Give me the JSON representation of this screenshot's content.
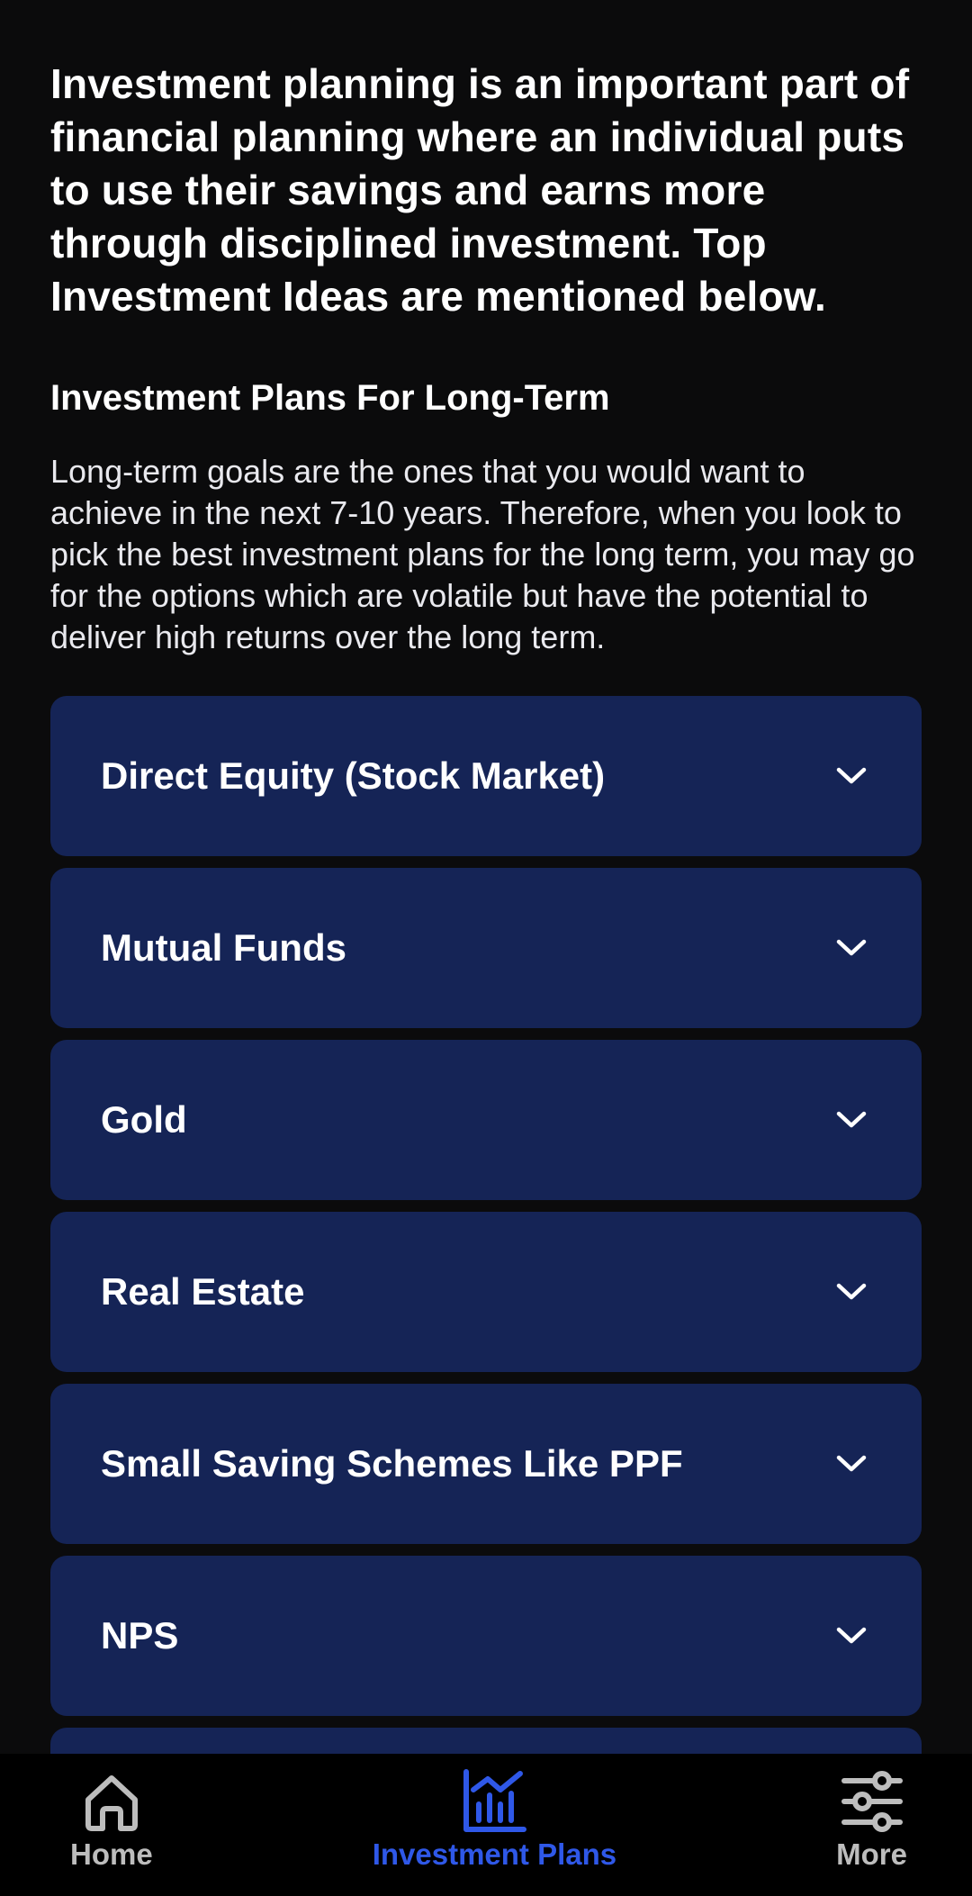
{
  "intro_text": "Investment planning is an important part of financial planning where an individual puts to use their savings and earns more through disciplined investment. Top Investment Ideas are mentioned below.",
  "section": {
    "title": "Investment Plans For Long-Term",
    "description": "Long-term goals are the ones that you would want to achieve in the next 7-10 years. Therefore, when you look to pick the best investment plans for the long term, you may go for the options which are volatile but have the potential to deliver high returns over the long term."
  },
  "accordion": {
    "items": [
      {
        "label": "Direct Equity (Stock Market)",
        "icon": "chevron-down-icon"
      },
      {
        "label": "Mutual Funds",
        "icon": "chevron-down-icon"
      },
      {
        "label": "Gold",
        "icon": "chevron-down-icon"
      },
      {
        "label": "Real Estate",
        "icon": "chevron-down-icon"
      },
      {
        "label": "Small Saving Schemes Like PPF",
        "icon": "chevron-down-icon"
      },
      {
        "label": "NPS",
        "icon": "chevron-down-icon"
      }
    ]
  },
  "bottom_nav": {
    "items": [
      {
        "label": "Home",
        "icon": "home-icon",
        "active": false
      },
      {
        "label": "Investment Plans",
        "icon": "bar-chart-icon",
        "active": true
      },
      {
        "label": "More",
        "icon": "sliders-icon",
        "active": false
      }
    ]
  },
  "colors": {
    "background": "#0b0b0c",
    "card": "#152456",
    "active_nav": "#2f58e8",
    "inactive_nav": "#bdbdbd"
  }
}
